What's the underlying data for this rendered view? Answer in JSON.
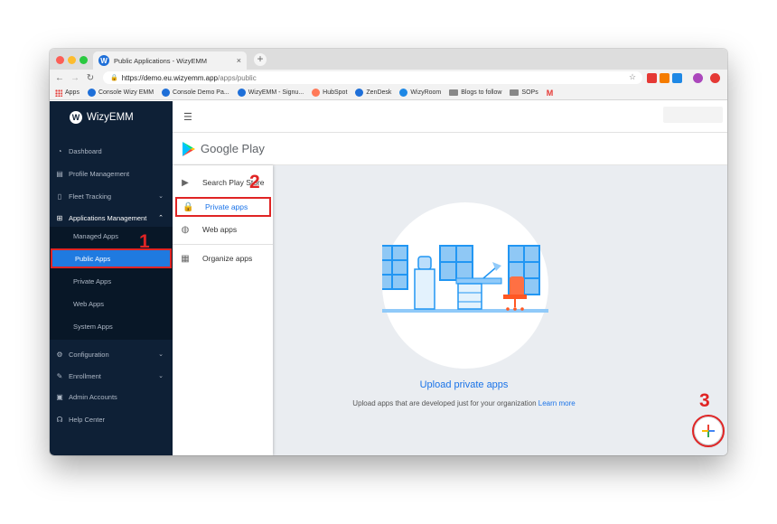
{
  "browser": {
    "tab_title": "Public Applications - WizyEMM",
    "tab_close": "×",
    "new_tab": "+",
    "url_host": "https://demo.eu.wizyemm.app",
    "url_path": "/apps/public",
    "bookmarks": [
      "Apps",
      "Console Wizy EMM",
      "Console Demo Pa...",
      "WizyEMM - Signu...",
      "HubSpot",
      "ZenDesk",
      "WizyRoom",
      "Blogs to follow",
      "SOPs"
    ]
  },
  "sidebar": {
    "brand": "WizyEMM",
    "items": [
      {
        "label": "Dashboard",
        "icon": "dashboard-icon"
      },
      {
        "label": "Profile Management",
        "icon": "profile-icon"
      },
      {
        "label": "Fleet Tracking",
        "icon": "phone-icon"
      },
      {
        "label": "Applications Management",
        "icon": "apps-icon"
      },
      {
        "label": "Configuration",
        "icon": "gear-icon"
      },
      {
        "label": "Enrollment",
        "icon": "edit-icon"
      },
      {
        "label": "Admin Accounts",
        "icon": "admin-icon"
      },
      {
        "label": "Help Center",
        "icon": "headset-icon"
      }
    ],
    "submenu": [
      "Managed Apps",
      "Public Apps",
      "Private Apps",
      "Web Apps",
      "System Apps"
    ],
    "active_submenu": "Public Apps"
  },
  "google_play": {
    "title": "Google Play",
    "nav": [
      "Search Play Store",
      "Private apps",
      "Web apps",
      "Organize apps"
    ],
    "active": "Private apps"
  },
  "content": {
    "title": "Upload private apps",
    "subtitle": "Upload apps that are developed just for your organization",
    "learn_more": "Learn more"
  },
  "callouts": [
    "1",
    "2",
    "3"
  ],
  "colors": {
    "sidebar": "#0e2036",
    "accent": "#1a73e8",
    "highlight": "#e02424"
  }
}
